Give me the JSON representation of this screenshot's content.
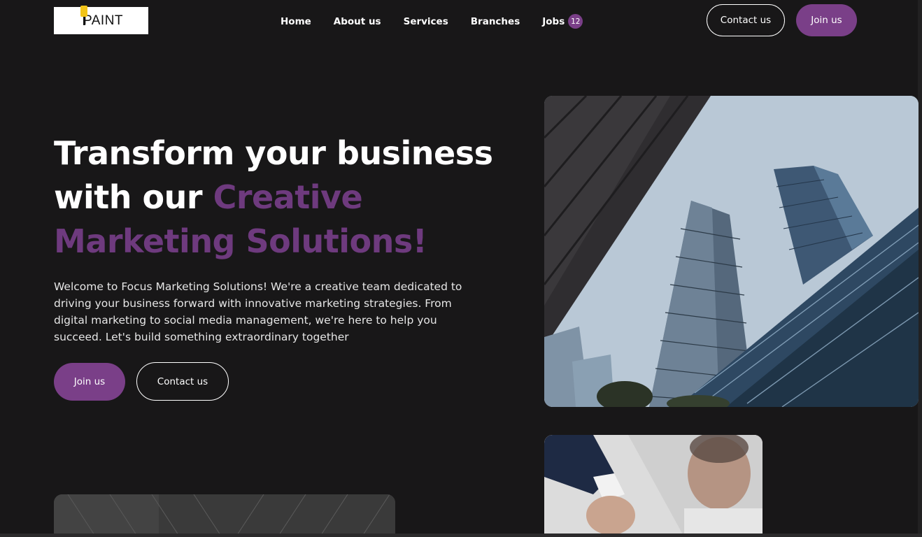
{
  "header": {
    "logo_text": "PAINT",
    "nav": [
      {
        "label": "Home"
      },
      {
        "label": "About us"
      },
      {
        "label": "Services"
      },
      {
        "label": "Branches"
      },
      {
        "label": "Jobs",
        "badge": "12"
      }
    ],
    "contact_label": "Contact us",
    "join_label": "Join us"
  },
  "hero": {
    "title_line1": "Transform your business",
    "title_line2_plain": "with our ",
    "title_line2_accent": "Creative",
    "title_line3_accent": "Marketing Solutions!",
    "description": "Welcome to Focus Marketing Solutions! We're a creative team dedicated to driving your business forward with innovative marketing strategies. From digital marketing to social media management, we're here to help you succeed. Let's build something extraordinary together",
    "join_label": "Join us",
    "contact_label": "Contact us"
  },
  "colors": {
    "background": "#181718",
    "accent": "#7a3f88",
    "accent_text": "#6e3a7e",
    "logo_brush": "#f2c418"
  },
  "images": {
    "main": "skyscrapers-photo",
    "secondary": "handshake-photo",
    "bottom_left": "building-facade-photo"
  }
}
